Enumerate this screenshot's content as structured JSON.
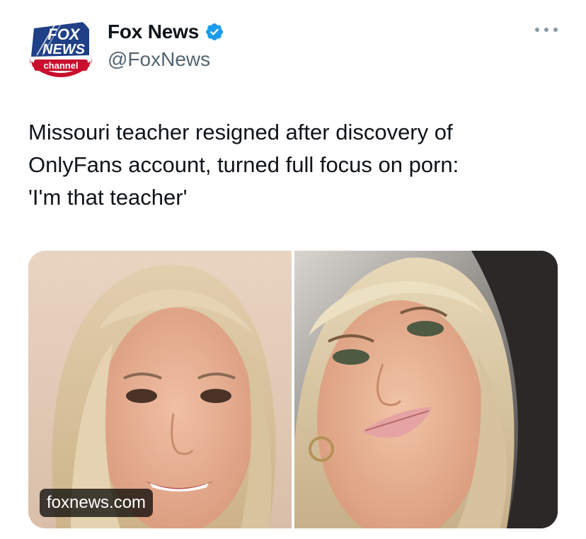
{
  "author": {
    "display_name": "Fox News",
    "handle": "@FoxNews",
    "verified": true,
    "avatar_logo": {
      "line1": "FOX",
      "line2": "NEWS",
      "line3": "channel"
    }
  },
  "tweet": {
    "text_lines": [
      "Missouri teacher resigned after discovery of",
      "OnlyFans account, turned full focus on porn:",
      "'I'm that teacher'"
    ]
  },
  "media": {
    "source_label": "foxnews.com",
    "photos": [
      "photo-left",
      "photo-right"
    ]
  },
  "icons": {
    "verified": "verified-badge-icon",
    "more": "more-options-icon"
  },
  "colors": {
    "verified_blue": "#1d9bf0",
    "handle_gray": "#536471",
    "fox_blue": "#1f3f86",
    "fox_red": "#c8102e"
  }
}
